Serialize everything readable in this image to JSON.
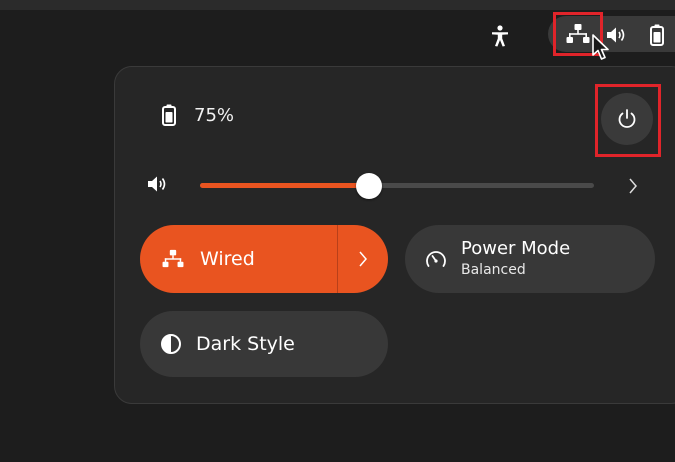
{
  "tray": {
    "accessibility_icon": "accessibility-icon",
    "network_icon": "network-wired-icon",
    "volume_icon": "speaker-icon",
    "battery_icon": "battery-icon"
  },
  "panel": {
    "battery": {
      "icon": "battery-icon",
      "percent_label": "75%"
    },
    "power_button": {
      "icon": "power-icon"
    },
    "volume": {
      "icon": "speaker-icon",
      "level": 0.43,
      "expand_icon": "chevron-right-icon"
    },
    "tiles": {
      "wired": {
        "icon": "network-wired-icon",
        "label": "Wired",
        "active": true,
        "arrow_icon": "chevron-right-icon"
      },
      "power_mode": {
        "icon": "gauge-icon",
        "label": "Power Mode",
        "subtitle": "Balanced",
        "active": false
      },
      "dark_style": {
        "icon": "half-circle-icon",
        "label": "Dark Style",
        "active": false
      }
    }
  },
  "colors": {
    "accent": "#e95420",
    "highlight_box": "#e0242a",
    "panel_bg": "#262626",
    "tile_bg": "#383838"
  }
}
